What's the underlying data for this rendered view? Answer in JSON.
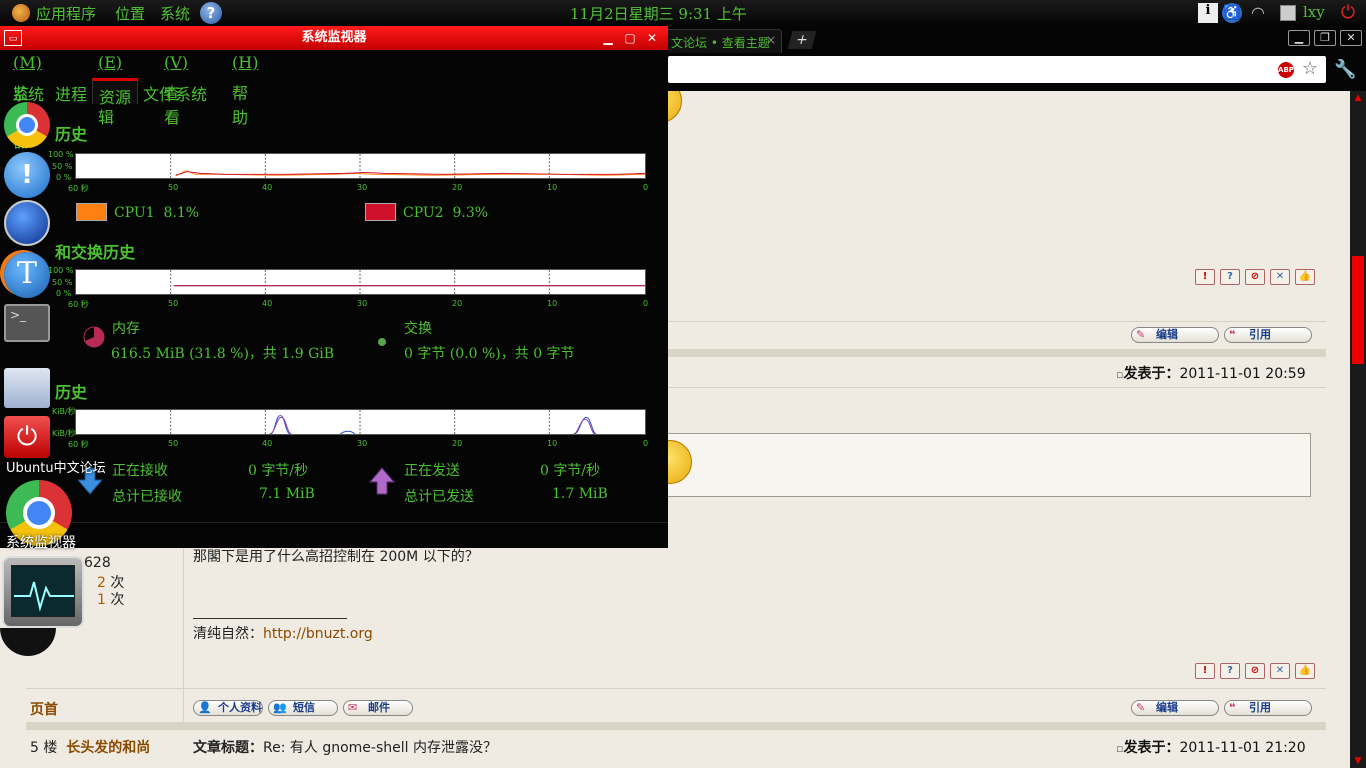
{
  "top_panel": {
    "menus": [
      "应用程序",
      "位置",
      "系统"
    ],
    "clock": "11月2日星期三  9:31 上午",
    "user": "lxy"
  },
  "browser": {
    "tab_title": "文论坛 • 查看主题",
    "tab_close": "×",
    "new_tab": "+",
    "abp_label": "ABP"
  },
  "forum": {
    "post1": {
      "posted_label": "发表于：",
      "posted_at": "2011-11-01 20:59",
      "edit_label": "编辑",
      "quote_label": "引用"
    },
    "post2": {
      "user_stat_num": "628",
      "stat_a_num": "2",
      "stat_b_num": "1",
      "stat_unit": "次",
      "body": "那閣下是用了什么高招控制在 200M 以下的？",
      "signature_prefix": "清纯自然：",
      "signature_link": "http://bnuzt.org",
      "top_link": "页首",
      "profile_btn": "个人资料",
      "pm_btn": "短信",
      "email_btn": "邮件",
      "edit_label": "编辑",
      "quote_label": "引用"
    },
    "post3": {
      "floor": "5 楼",
      "author": "长头发的和尚",
      "subject_label": "文章标题：",
      "subject": "Re: 有人 gnome-shell 内存泄露没？",
      "posted_label": "发表于：",
      "posted_at": "2011-11-01 21:20"
    }
  },
  "sysmon": {
    "title": "系统监视器",
    "menus": [
      {
        "label": "监视器",
        "key": "(M)"
      },
      {
        "label": "编辑",
        "key": "(E)"
      },
      {
        "label": "查看",
        "key": "(V)"
      },
      {
        "label": "帮助",
        "key": "(H)"
      }
    ],
    "tabs": [
      "系统",
      "进程",
      "资源",
      "文件系统"
    ],
    "active_tab": "资源",
    "cpu": {
      "title": "历史",
      "y_labels": [
        "100 %",
        "50 %",
        "0 %"
      ],
      "series": [
        {
          "name": "CPU1",
          "value": "8.1%",
          "color": "#ff8010"
        },
        {
          "name": "CPU2",
          "value": "9.3%",
          "color": "#d0112b"
        }
      ]
    },
    "mem": {
      "title": "和交换历史",
      "y_labels": [
        "100 %",
        "50 %",
        "0 %"
      ],
      "mem_label": "内存",
      "mem_value": "616.5 MiB (31.8 %)，共 1.9 GiB",
      "mem_color": "#b82a56",
      "swap_label": "交换",
      "swap_value": "0 字节 (0.0 %)，共 0 字节",
      "swap_color": "#57a54b"
    },
    "net": {
      "title": "历史",
      "y_labels": [
        "KiB/秒",
        "KiB/秒"
      ],
      "recv_label": "正在接收",
      "recv_rate": "0 字节/秒",
      "recv_total_label": "总计已接收",
      "recv_total": "7.1 MiB",
      "send_label": "正在发送",
      "send_rate": "0 字节/秒",
      "send_total_label": "总计已发送",
      "send_total": "1.7 MiB"
    },
    "x_ticks": [
      "60 秒",
      "50",
      "40",
      "30",
      "20",
      "10",
      "0"
    ]
  },
  "dock": {
    "forum_label": "Ubuntu中文论坛",
    "sysmon_label": "系统监视器"
  }
}
